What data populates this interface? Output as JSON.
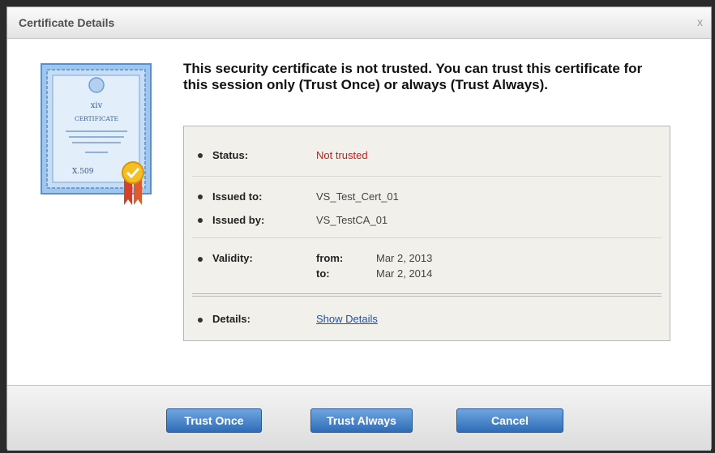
{
  "dialog": {
    "title": "Certificate Details",
    "close_glyph": "x"
  },
  "icon": {
    "name": "certificate-icon",
    "heading": "xiv",
    "label": "CERTIFICATE",
    "standard": "X.509"
  },
  "message": "This security certificate is not trusted. You can trust this certificate for this session only (Trust Once) or always (Trust Always).",
  "details": {
    "status_label": "Status:",
    "status_value": "Not trusted",
    "issued_to_label": "Issued to:",
    "issued_to_value": "VS_Test_Cert_01",
    "issued_by_label": "Issued by:",
    "issued_by_value": "VS_TestCA_01",
    "validity_label": "Validity:",
    "from_label": "from:",
    "from_value": "Mar 2, 2013",
    "to_label": "to:",
    "to_value": "Mar 2, 2014",
    "details_label": "Details:",
    "details_link": "Show Details"
  },
  "buttons": {
    "trust_once": "Trust Once",
    "trust_always": "Trust Always",
    "cancel": "Cancel"
  },
  "colors": {
    "status_untrusted": "#e21010",
    "link": "#1f4fb8",
    "button": "#3d7cc6"
  }
}
